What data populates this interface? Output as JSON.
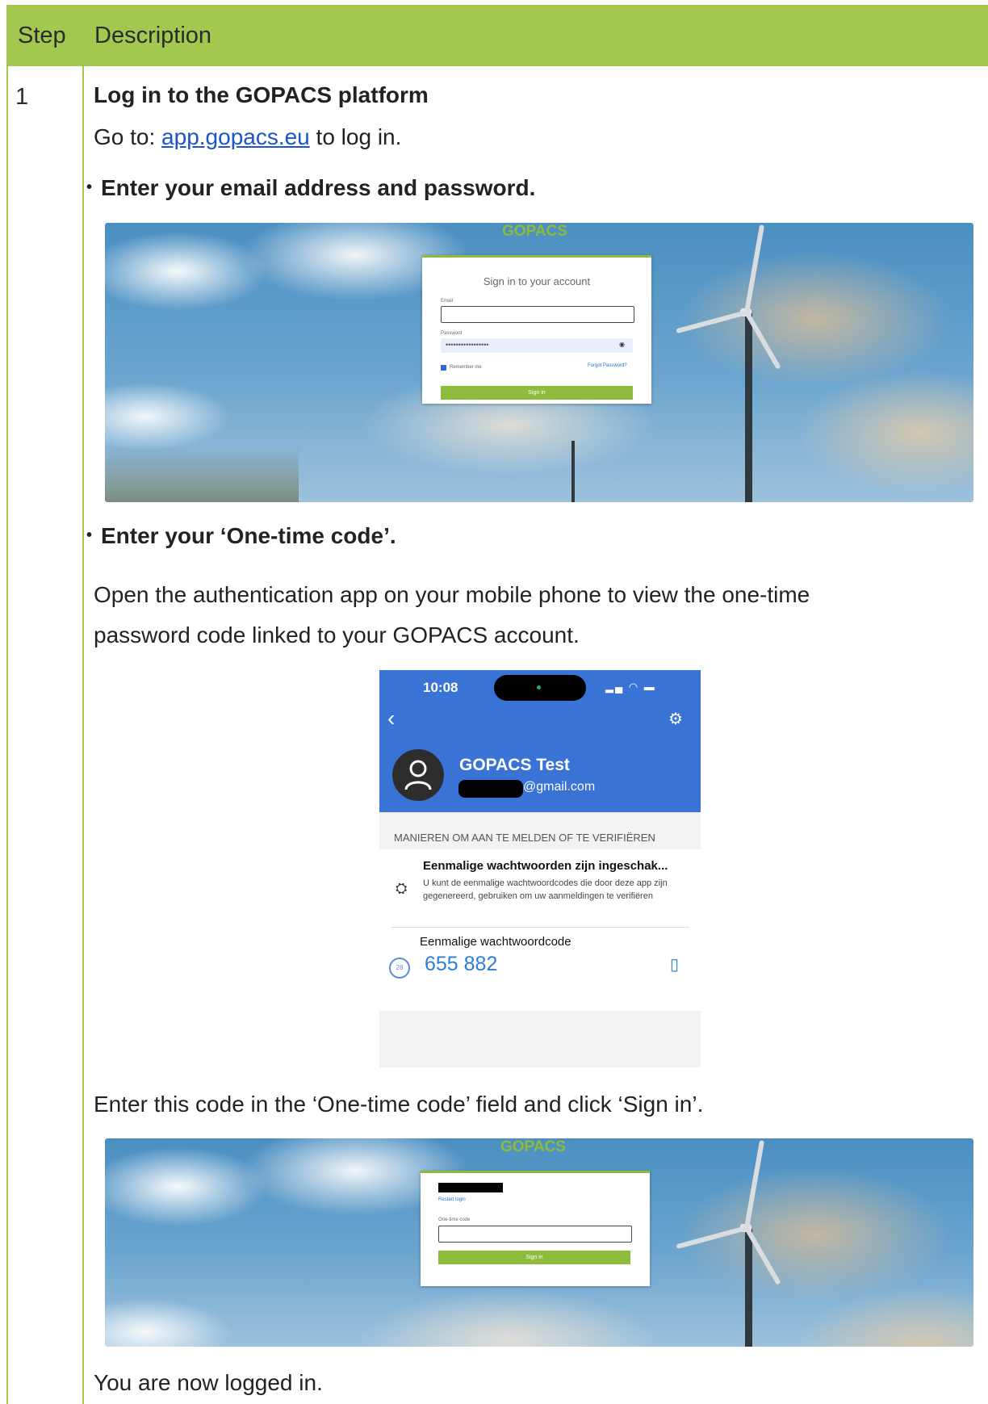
{
  "header": {
    "step": "Step",
    "description": "Description"
  },
  "step": {
    "number": "1",
    "title": "Log in to the GOPACS platform",
    "goto_prefix": "Go to: ",
    "goto_link": "app.gopacs.eu",
    "goto_suffix": " to log in.",
    "bullet1": "Enter your email address and password.",
    "bullet2": "Enter your ‘One-time code’.",
    "para1_line1": "Open the authentication app on your mobile phone to view the one-time",
    "para1_line2": "password code linked to your GOPACS account.",
    "para2": "Enter this code in the ‘One-time code’ field and click ‘Sign in’.",
    "para3": "You are now logged in."
  },
  "login_screen": {
    "logo": "GOPACS",
    "title": "Sign in to your account",
    "email_label": "Email",
    "password_label": "Password",
    "password_value": "•••••••••••••••••",
    "remember": "Remember me",
    "forgot": "Forgot Password?",
    "signin": "Sign in"
  },
  "phone": {
    "time": "10:08",
    "account_name": "GOPACS Test",
    "account_email": "@gmail.com",
    "section": "MANIEREN OM AAN TE MELDEN OF TE VERIFIËREN",
    "item1_title": "Eenmalige wachtwoorden zijn ingeschak...",
    "item1_desc": "U kunt de eenmalige wachtwoordcodes die door deze app zijn gegenereerd, gebruiken om uw aanmeldingen te verifiëren",
    "item2_title": "Eenmalige wachtwoordcode",
    "code": "655 882",
    "timer": "28"
  },
  "otp_screen": {
    "logo": "GOPACS",
    "restart": "Restart login",
    "otp_label": "One-time code",
    "signin": "Sign in"
  },
  "colors": {
    "header_green": "#a4c84f",
    "link_blue": "#1a55c9",
    "brand_green": "#8dbb3b",
    "phone_blue": "#3a73d6"
  }
}
